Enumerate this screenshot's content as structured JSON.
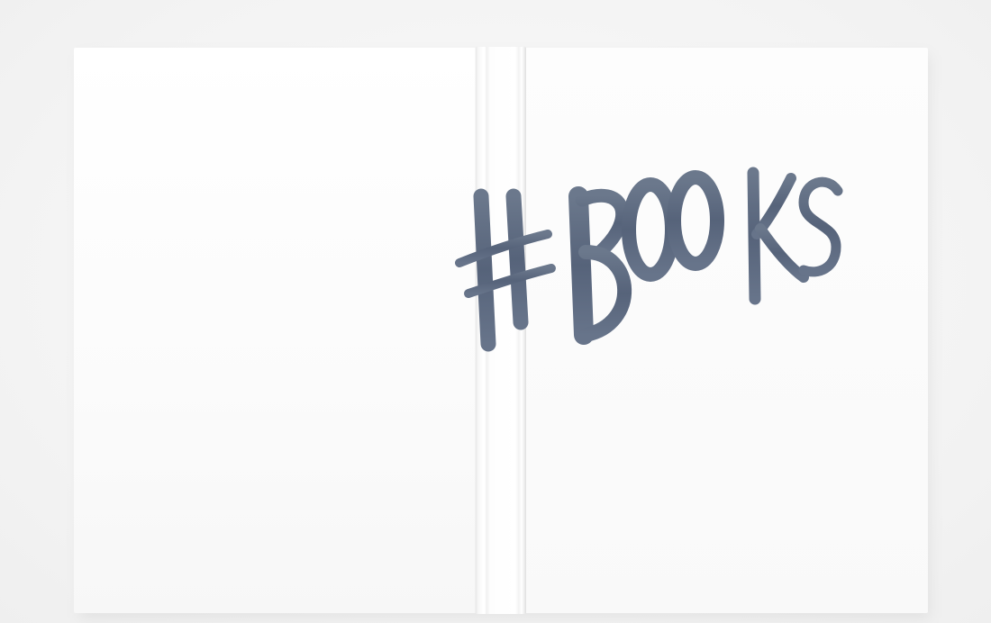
{
  "scene": {
    "subject": "hardcover-notebook-mockup",
    "background_color": "#f3f3f3",
    "cover_color": "#ffffff",
    "ink_color": "#5d6b80"
  },
  "front_cover": {
    "lettering": "#BOOKS"
  }
}
